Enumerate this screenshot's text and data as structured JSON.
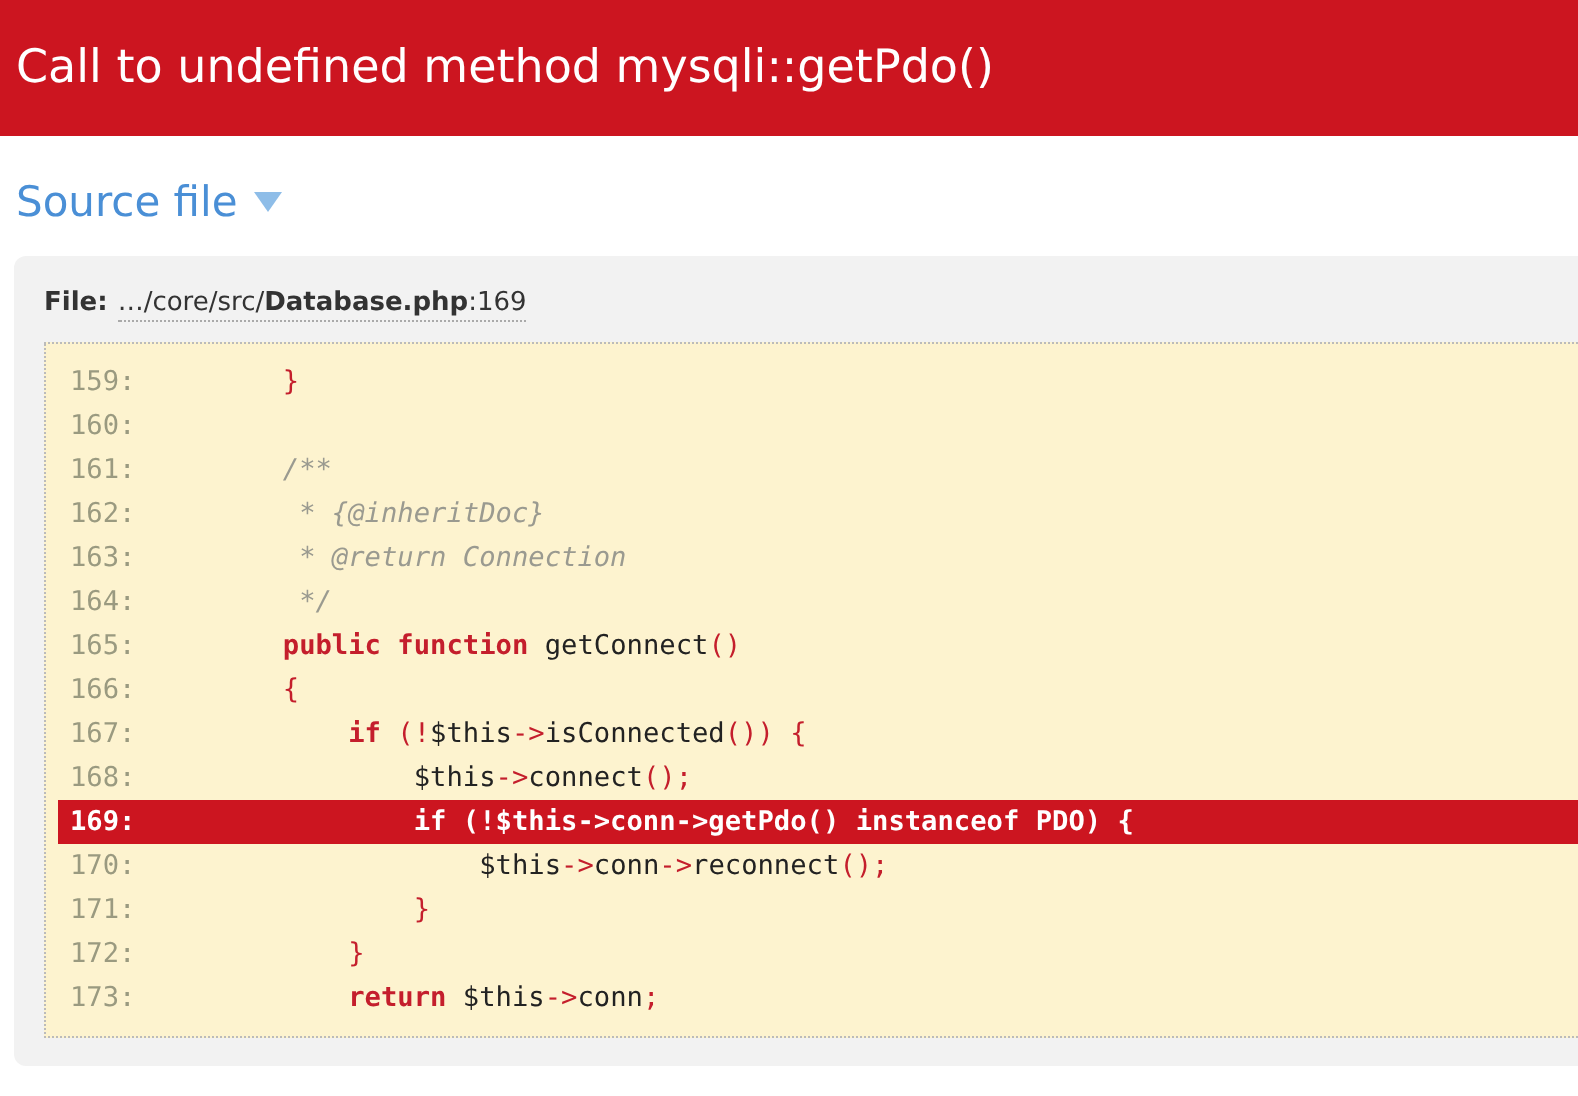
{
  "header": {
    "title": "Call to undefined method mysqli::getPdo()"
  },
  "section": {
    "title": "Source file",
    "expanded": true
  },
  "file": {
    "label": "File:",
    "path": "…/core/src/**Database.php**:169"
  },
  "lines": [
    {
      "number": "159:",
      "highlighted": false,
      "tokens": [
        {
          "kind": "punct",
          "text": "        }"
        }
      ]
    },
    {
      "number": "160:",
      "highlighted": false
    },
    {
      "number": "161:",
      "highlighted": false,
      "tokens": [
        {
          "kind": "comment",
          "text": "        /**"
        }
      ]
    },
    {
      "number": "162:",
      "highlighted": false,
      "tokens": [
        {
          "kind": "comment",
          "text": "         * {@inheritDoc}"
        }
      ]
    },
    {
      "number": "163:",
      "highlighted": false,
      "tokens": [
        {
          "kind": "comment",
          "text": "         * @return Connection"
        }
      ]
    },
    {
      "number": "164:",
      "highlighted": false,
      "tokens": [
        {
          "kind": "comment",
          "text": "         */"
        }
      ]
    },
    {
      "number": "165:",
      "highlighted": false,
      "tokens": [
        {
          "kind": "keyword",
          "text": "        public "
        },
        {
          "kind": "keyword",
          "text": "function"
        },
        {
          "kind": "plain",
          "text": " getConnect"
        },
        {
          "kind": "punct",
          "text": "()"
        }
      ]
    },
    {
      "number": "166:",
      "highlighted": false,
      "tokens": [
        {
          "kind": "punct",
          "text": "        {"
        }
      ]
    },
    {
      "number": "167:",
      "highlighted": false,
      "tokens": [
        {
          "kind": "keyword",
          "text": "            if "
        },
        {
          "kind": "punct",
          "text": "(!"
        },
        {
          "kind": "plain",
          "text": "$this"
        },
        {
          "kind": "punct",
          "text": "->"
        },
        {
          "kind": "plain",
          "text": "isConnected"
        },
        {
          "kind": "punct",
          "text": "()) {"
        }
      ]
    },
    {
      "number": "168:",
      "highlighted": false,
      "tokens": [
        {
          "kind": "plain",
          "text": "                $this"
        },
        {
          "kind": "punct",
          "text": "->"
        },
        {
          "kind": "plain",
          "text": "connect"
        },
        {
          "kind": "punct",
          "text": "();"
        }
      ]
    },
    {
      "number": "169:",
      "highlighted": true,
      "tokens": [
        {
          "kind": "plain",
          "text": "                if (!$this->conn->getPdo() instanceof PDO) {"
        }
      ]
    },
    {
      "number": "170:",
      "highlighted": false,
      "tokens": [
        {
          "kind": "plain",
          "text": "                    $this"
        },
        {
          "kind": "punct",
          "text": "->"
        },
        {
          "kind": "plain",
          "text": "conn"
        },
        {
          "kind": "punct",
          "text": "->"
        },
        {
          "kind": "plain",
          "text": "reconnect"
        },
        {
          "kind": "punct",
          "text": "();"
        }
      ]
    },
    {
      "number": "171:",
      "highlighted": false,
      "tokens": [
        {
          "kind": "punct",
          "text": "                }"
        }
      ]
    },
    {
      "number": "172:",
      "highlighted": false,
      "tokens": [
        {
          "kind": "punct",
          "text": "            }"
        }
      ]
    },
    {
      "number": "173:",
      "highlighted": false,
      "tokens": [
        {
          "kind": "keyword",
          "text": "            return"
        },
        {
          "kind": "plain",
          "text": " $this"
        },
        {
          "kind": "punct",
          "text": "->"
        },
        {
          "kind": "plain",
          "text": "conn"
        },
        {
          "kind": "punct",
          "text": ";"
        }
      ]
    }
  ]
}
